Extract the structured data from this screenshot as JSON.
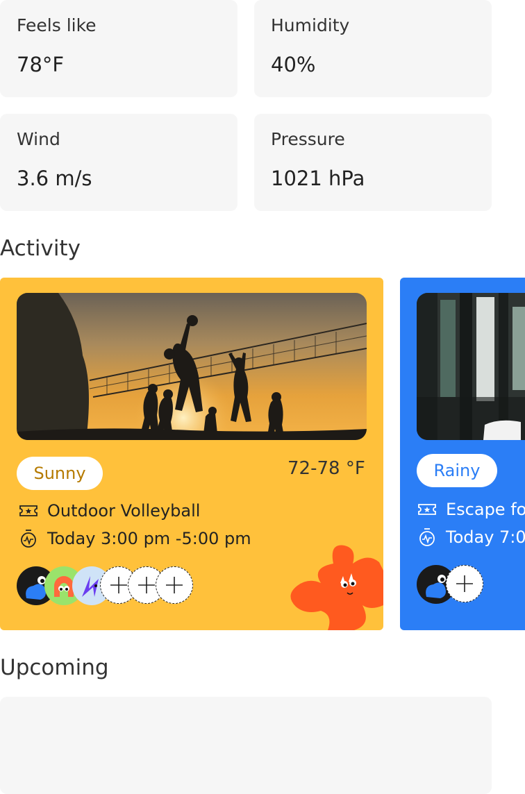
{
  "stats": [
    {
      "label": "Feels like",
      "value": "78°F"
    },
    {
      "label": "Humidity",
      "value": "40%"
    },
    {
      "label": "Wind",
      "value": "3.6 m/s"
    },
    {
      "label": "Pressure",
      "value": "1021 hPa"
    }
  ],
  "activity": {
    "title": "Activity",
    "cards": [
      {
        "weather": "Sunny",
        "temp_range": "72-78 °F",
        "activity": "Outdoor Volleyball",
        "time": "Today 3:00 pm -5:00 pm",
        "accent": "#ffc13b",
        "pill_text_color": "#b57a00"
      },
      {
        "weather": "Rainy",
        "activity": "Escape for",
        "time": "Today 7:0",
        "accent": "#2b7ef6",
        "pill_text_color": "#2b7ef6"
      }
    ]
  },
  "upcoming": {
    "title": "Upcoming"
  }
}
